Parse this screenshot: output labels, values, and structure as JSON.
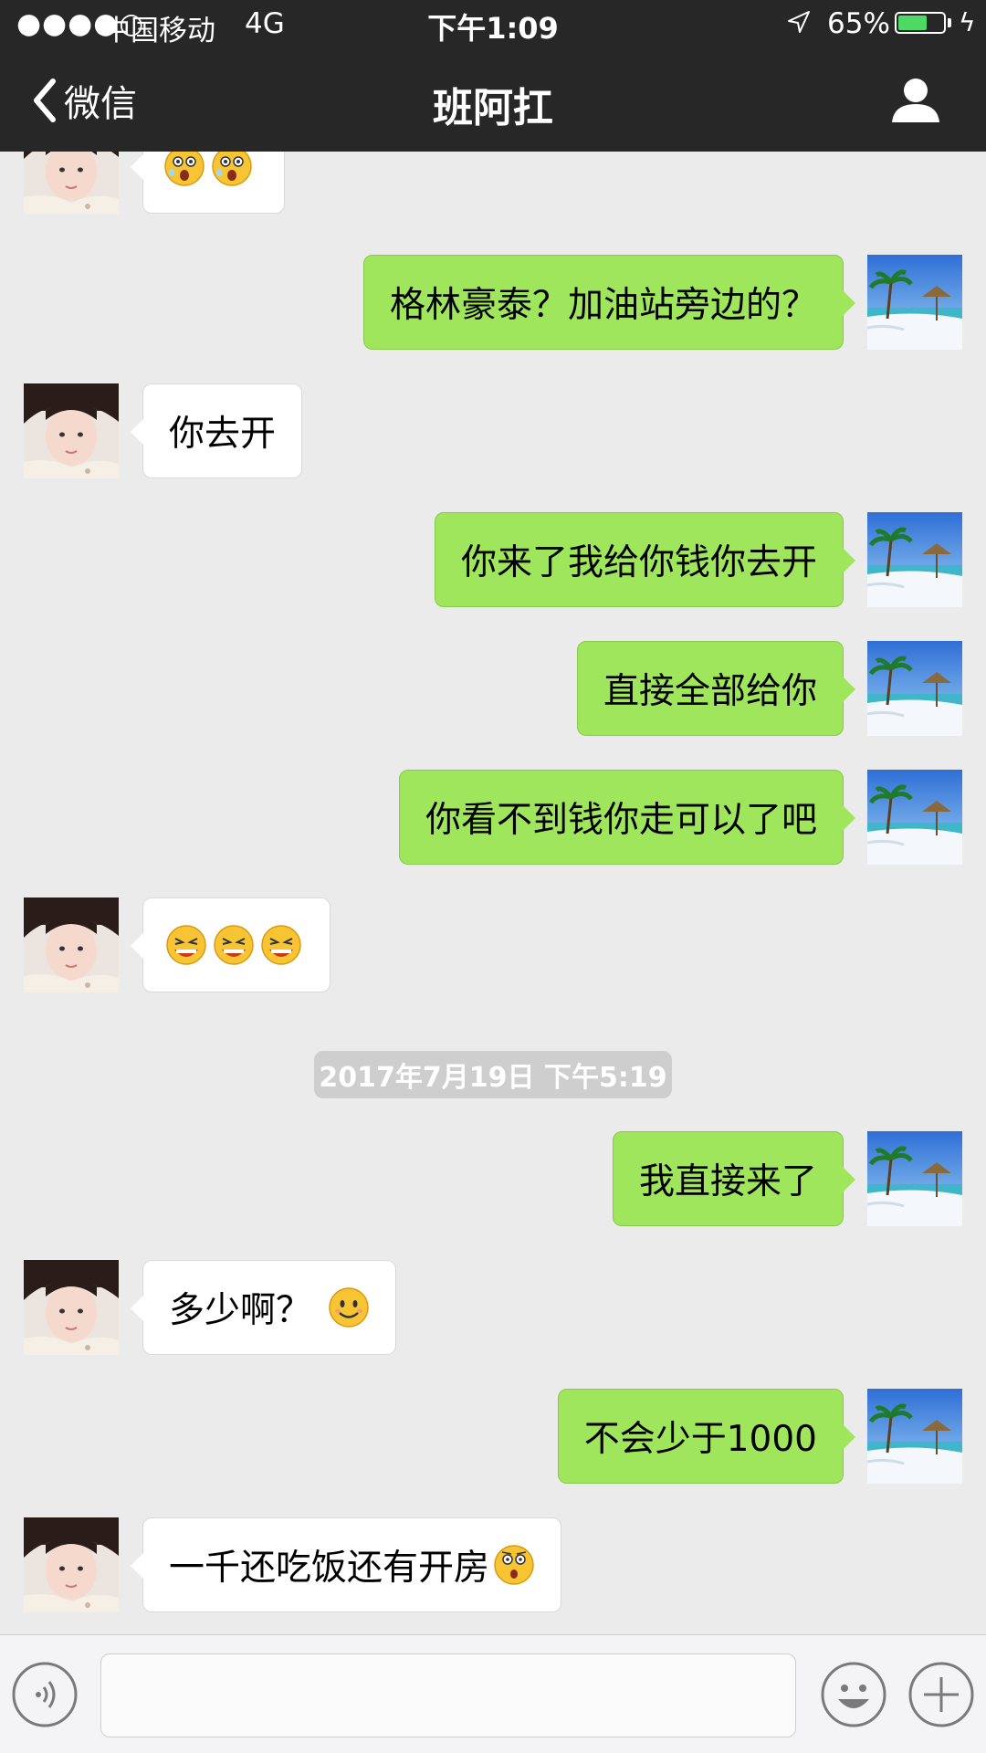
{
  "status_bar": {
    "signal": "●●●●○",
    "carrier": "中国移动",
    "network": "4G",
    "time": "下午1:09",
    "battery_pct": "65%",
    "battery_level": 0.65,
    "battery_color": "#4cd964"
  },
  "nav": {
    "back_label": "微信",
    "title": "班阿扛",
    "profile_icon": "person-icon"
  },
  "messages": [
    {
      "side": "in",
      "emojis": [
        "surprised",
        "surprised"
      ]
    },
    {
      "side": "out",
      "text": "格林豪泰？加油站旁边的？"
    },
    {
      "side": "in",
      "text": "你去开"
    },
    {
      "side": "out",
      "text": "你来了我给你钱你去开"
    },
    {
      "side": "out",
      "text": "直接全部给你"
    },
    {
      "side": "out",
      "text": "你看不到钱你走可以了吧"
    },
    {
      "side": "in",
      "emojis": [
        "grimace",
        "grimace",
        "grimace"
      ]
    },
    {
      "type": "timestamp",
      "text": "2017年7月19日 下午5:19"
    },
    {
      "side": "out",
      "text": "我直接来了"
    },
    {
      "side": "in",
      "text": "多少啊？",
      "emoji": "smile"
    },
    {
      "side": "out",
      "text": "不会少于1000"
    },
    {
      "side": "in",
      "text": "一千还吃饭还有开房",
      "emoji": "shocked"
    }
  ],
  "colors": {
    "header_bg": "#272727",
    "chat_bg": "#ebebeb",
    "outgoing_bubble": "#9fe65d",
    "incoming_bubble": "#ffffff"
  },
  "input_bar": {
    "voice_icon": "voice-icon",
    "emoji_icon": "emoji-face-icon",
    "plus_icon": "plus-icon"
  }
}
